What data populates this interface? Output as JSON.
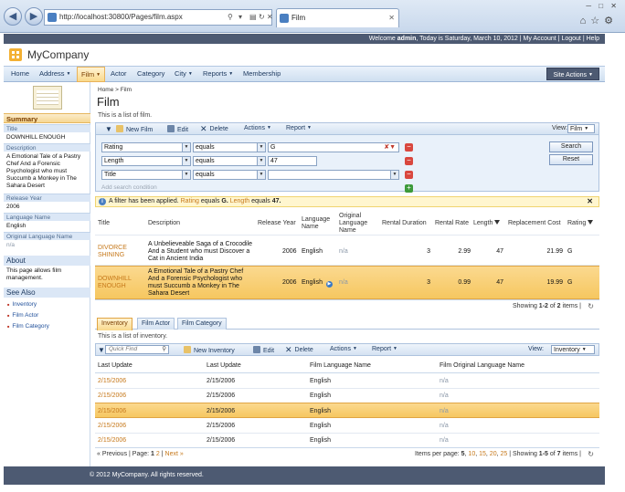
{
  "browser": {
    "url": "http://localhost:30800/Pages/film.aspx",
    "tab_title": "Film"
  },
  "topbar": {
    "welcome_prefix": "Welcome ",
    "user": "admin",
    "date_text": ", Today is Saturday, March 10, 2012",
    "my_account": "My Account",
    "logout": "Logout",
    "help": "Help"
  },
  "app": {
    "company": "MyCompany"
  },
  "menu": {
    "items": [
      "Home",
      "Address",
      "Film",
      "Actor",
      "Category",
      "City",
      "Reports",
      "Membership"
    ],
    "selected": "Film",
    "site_actions": "Site Actions"
  },
  "sidebar": {
    "summary_title": "Summary",
    "fields": [
      {
        "label": "Title",
        "value": "DOWNHILL ENOUGH"
      },
      {
        "label": "Description",
        "value": "A Emotional Tale of a Pastry Chef And a Forensic Psychologist who must Succumb a Monkey in The Sahara Desert"
      },
      {
        "label": "Release Year",
        "value": "2006"
      },
      {
        "label": "Language Name",
        "value": "English"
      },
      {
        "label": "Original Language Name",
        "value": "n/a"
      }
    ],
    "about_title": "About",
    "about_text": "This page allows film management.",
    "see_also_title": "See Also",
    "see_also": [
      "Inventory",
      "Film Actor",
      "Film Category"
    ]
  },
  "page": {
    "breadcrumb_home": "Home",
    "breadcrumb_sep": ">",
    "breadcrumb_current": "Film",
    "title": "Film",
    "intro": "This is a list of film."
  },
  "toolbar": {
    "new": "New Film",
    "edit": "Edit",
    "delete": "Delete",
    "actions": "Actions",
    "report": "Report",
    "view_label": "View:",
    "view_value": "Film"
  },
  "filters": {
    "rows": [
      {
        "field": "Rating",
        "op": "equals",
        "value": "G"
      },
      {
        "field": "Length",
        "op": "equals",
        "value": "47"
      },
      {
        "field": "Title",
        "op": "equals",
        "value": ""
      }
    ],
    "add_condition": "Add search condition",
    "search": "Search",
    "reset": "Reset"
  },
  "filter_note": {
    "prefix": "A filter has been applied.",
    "f1": "Rating",
    "eq1": "equals",
    "v1": "G.",
    "f2": "Length",
    "eq2": "equals",
    "v2": "47."
  },
  "film_grid": {
    "columns": [
      "Title",
      "Description",
      "Release Year",
      "Language Name",
      "Original Language Name",
      "Rental Duration",
      "Rental Rate",
      "Length",
      "Replacement Cost",
      "Rating"
    ],
    "rows": [
      {
        "title": "DIVORCE SHINING",
        "description": "A Unbelieveable Saga of a Crocodile And a Student who must Discover a Cat in Ancient India",
        "release_year": "2006",
        "language": "English",
        "original_language": "n/a",
        "rental_duration": "3",
        "rental_rate": "2.99",
        "length": "47",
        "replacement_cost": "21.99",
        "rating": "G"
      },
      {
        "title": "DOWNHILL ENOUGH",
        "description": "A Emotional Tale of a Pastry Chef And a Forensic Psychologist who must Succumb a Monkey in The Sahara Desert",
        "release_year": "2006",
        "language": "English",
        "original_language": "n/a",
        "rental_duration": "3",
        "rental_rate": "0.99",
        "length": "47",
        "replacement_cost": "19.99",
        "rating": "G"
      }
    ],
    "pager_prefix": "Showing ",
    "pager_range": "1-2",
    "pager_of": " of ",
    "pager_total": "2",
    "pager_suffix": " items |"
  },
  "child": {
    "tabs": [
      "Inventory",
      "Film Actor",
      "Film Category"
    ],
    "selected_tab": "Inventory",
    "intro": "This is a list of inventory.",
    "quick_find": "Quick Find",
    "new": "New Inventory",
    "edit": "Edit",
    "delete": "Delete",
    "actions": "Actions",
    "report": "Report",
    "view_label": "View:",
    "view_value": "Inventory",
    "columns": [
      "Last Update",
      "Last Update",
      "Film Language Name",
      "Film Original Language Name"
    ],
    "rows": [
      [
        "2/15/2006",
        "2/15/2006",
        "English",
        "n/a"
      ],
      [
        "2/15/2006",
        "2/15/2006",
        "English",
        "n/a"
      ],
      [
        "2/15/2006",
        "2/15/2006",
        "English",
        "n/a"
      ],
      [
        "2/15/2006",
        "2/15/2006",
        "English",
        "n/a"
      ],
      [
        "2/15/2006",
        "2/15/2006",
        "English",
        "n/a"
      ]
    ],
    "selected_row": 2,
    "pager_prev": "« Previous",
    "pager_page_label": "| Page:",
    "pager_pages": [
      "1",
      "2"
    ],
    "pager_next": "Next »",
    "items_per_page_label": "Items per page:",
    "items_per_page": [
      "5",
      "10",
      "15",
      "20",
      "25"
    ],
    "showing_prefix": "| Showing ",
    "showing_range": "1-5",
    "showing_of": " of ",
    "showing_total": "7",
    "showing_suffix": " items |"
  },
  "footer": {
    "text": "© 2012 MyCompany. All rights reserved."
  }
}
